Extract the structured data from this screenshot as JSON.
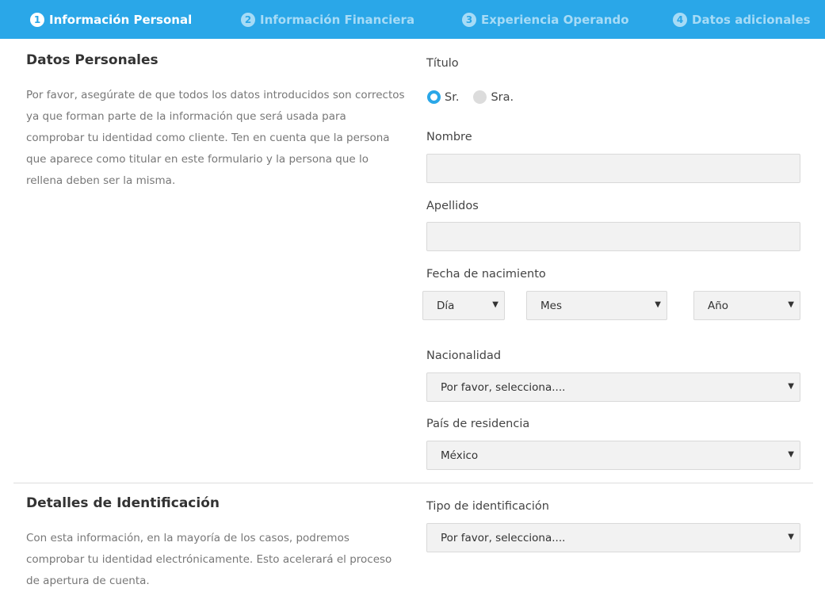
{
  "steps": [
    {
      "num": "1",
      "label": "Información Personal",
      "active": true
    },
    {
      "num": "2",
      "label": "Información Financiera",
      "active": false
    },
    {
      "num": "3",
      "label": "Experiencia Operando",
      "active": false
    },
    {
      "num": "4",
      "label": "Datos adicionales",
      "active": false
    }
  ],
  "personal": {
    "title": "Datos Personales",
    "description": "Por favor, asegúrate de que todos los datos introducidos son correctos ya que forman parte de la información que será usada para comprobar tu identidad como cliente. Ten en cuenta que la persona que aparece como titular en este formulario y la persona que lo rellena deben ser la misma."
  },
  "form": {
    "titulo_label": "Título",
    "titulo_options": [
      "Sr.",
      "Sra."
    ],
    "titulo_selected": "Sr.",
    "nombre_label": "Nombre",
    "nombre_value": "",
    "apellidos_label": "Apellidos",
    "apellidos_value": "",
    "fecha_label": "Fecha de nacimiento",
    "dia": "Día",
    "mes": "Mes",
    "ano": "Año",
    "nacionalidad_label": "Nacionalidad",
    "nacionalidad_value": "Por favor, selecciona....",
    "pais_label": "País de residencia",
    "pais_value": "México"
  },
  "identification": {
    "title": "Detalles de Identificación",
    "description": "Con esta información, en la mayoría de los casos, podremos comprobar tu identidad electrónicamente. Esto acelerará el proceso de apertura de cuenta.",
    "tipo_label": "Tipo de identificación",
    "tipo_value": "Por favor, selecciona...."
  },
  "icons": {
    "caret": "caret-down-icon"
  },
  "colors": {
    "accent": "#2aa7e8",
    "inactive_step": "#a6dbf6"
  }
}
